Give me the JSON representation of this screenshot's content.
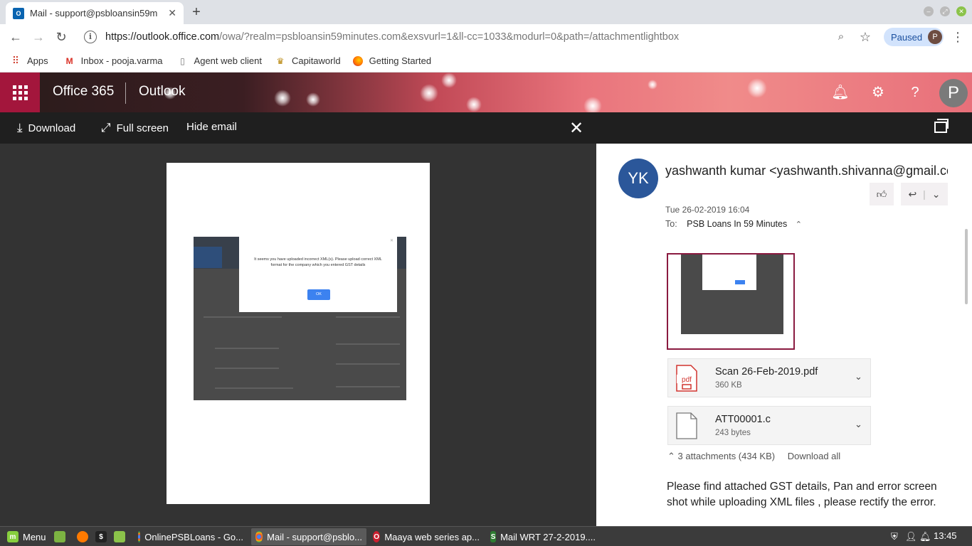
{
  "browser": {
    "tab_title": "Mail - support@psbloansin59m",
    "tab_favicon": "O",
    "url_domain": "https://outlook.office.com",
    "url_rest": "/owa/?realm=psbloansin59minutes.com&exsvurl=1&ll-cc=1033&modurl=0&path=/attachmentlightbox",
    "paused_label": "Paused",
    "profile_initial": "P",
    "bookmarks": [
      {
        "label": "Apps"
      },
      {
        "label": "Inbox - pooja.varma"
      },
      {
        "label": "Agent web client"
      },
      {
        "label": "Capitaworld"
      },
      {
        "label": "Getting Started"
      }
    ]
  },
  "o365": {
    "brand": "Office 365",
    "app": "Outlook",
    "me_initial": "P"
  },
  "lightbox": {
    "download_label": "Download",
    "fullscreen_label": "Full screen",
    "hide_email_label": "Hide email",
    "dialog_message": "It seems you have uploaded incorrect XML(s). Please upload correct XML format for the company which you entered GST details",
    "dialog_ok": "OK"
  },
  "email": {
    "avatar_initials": "YK",
    "sender": "yashwanth kumar <yashwanth.shivanna@gmail.com>",
    "date": "Tue 26-02-2019 16:04",
    "to_label": "To:",
    "recipient": "PSB Loans In 59 Minutes",
    "attachments": [
      {
        "name": "Scan 26-Feb-2019.pdf",
        "size": "360 KB",
        "type": "pdf"
      },
      {
        "name": "ATT00001.c",
        "size": "243 bytes",
        "type": "file"
      }
    ],
    "attachment_summary": "3 attachments (434 KB)",
    "download_all": "Download all",
    "body": "Please find attached GST details, Pan and error screen shot while uploading XML files , please rectify the error."
  },
  "taskbar": {
    "menu_label": "Menu",
    "items": [
      {
        "label": "OnlinePSBLoans - Go..."
      },
      {
        "label": "Mail - support@psblo..."
      },
      {
        "label": "Maaya web series ap..."
      },
      {
        "label": "Mail WRT 27-2-2019...."
      }
    ],
    "clock": "13:45"
  },
  "colors": {
    "o365_waffle": "#a3163c",
    "avatar": "#2b579a",
    "thumb_border": "#8a1a40",
    "paused_bg": "#d2e3fc"
  }
}
